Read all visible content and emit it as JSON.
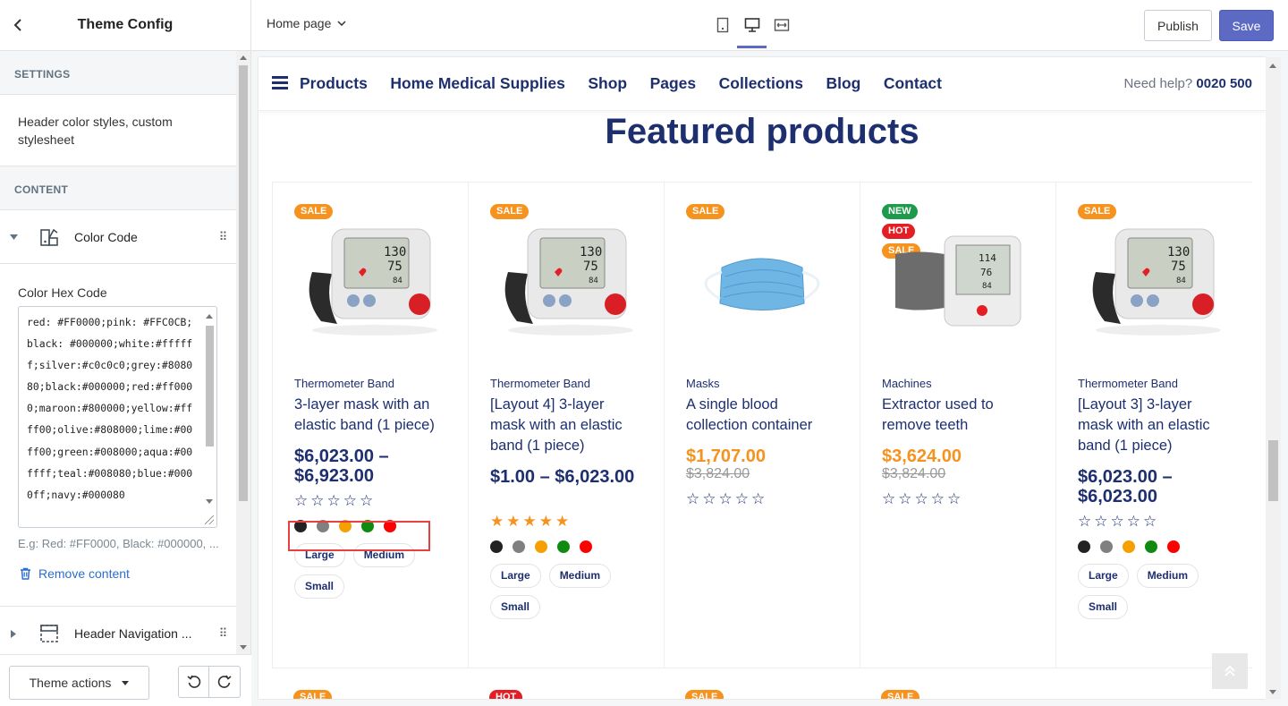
{
  "sidebar": {
    "title": "Theme Config",
    "settings_label": "SETTINGS",
    "settings_item": "Header color styles, custom stylesheet",
    "content_label": "CONTENT",
    "block1": {
      "name": "Color Code"
    },
    "field_label": "Color Hex Code",
    "textarea_value": "red: #FF0000;pink: #FFC0CB;black: #000000;white:#ffffff;silver:#c0c0c0;grey:#808080;black:#000000;red:#ff0000;maroon:#800000;yellow:#ffff00;olive:#808000;lime:#00ff00;green:#008000;aqua:#00ffff;teal:#008080;blue:#0000ff;navy:#000080",
    "hint": "E.g: Red: #FF0000, Black: #000000, ...",
    "remove_label": "Remove content",
    "block2": {
      "name": "Header Navigation ..."
    },
    "theme_actions_label": "Theme actions"
  },
  "topbar": {
    "page_label": "Home page",
    "publish_label": "Publish",
    "save_label": "Save"
  },
  "store": {
    "nav": [
      "Products",
      "Home Medical Supplies",
      "Shop",
      "Pages",
      "Collections",
      "Blog",
      "Contact"
    ],
    "help_label": "Need help?",
    "help_phone": "0020 500",
    "section_title": "Featured products"
  },
  "products": [
    {
      "badges": [
        "SALE"
      ],
      "category": "Thermometer Band",
      "name": "3-layer mask with an elastic band (1 piece)",
      "price": "$6,023.00 – $6,923.00",
      "old_price": "",
      "stars": "☆☆☆☆☆",
      "colors": [
        "#222222",
        "#808080",
        "#f6a000",
        "#118a11",
        "#ff0000"
      ],
      "sizes": [
        "Large",
        "Medium",
        "Small"
      ]
    },
    {
      "badges": [
        "SALE"
      ],
      "category": "Thermometer Band",
      "name": "[Layout 4] 3-layer mask with an elastic band (1 piece)",
      "price": "$1.00 – $6,023.00",
      "old_price": "",
      "stars": "★★★★★",
      "colors": [
        "#222222",
        "#808080",
        "#f6a000",
        "#118a11",
        "#ff0000"
      ],
      "sizes": [
        "Large",
        "Medium",
        "Small"
      ]
    },
    {
      "badges": [
        "SALE"
      ],
      "category": "Masks",
      "name": "A single blood collection container",
      "price": "$1,707.00",
      "old_price": "$3,824.00",
      "stars": "☆☆☆☆☆",
      "colors": [],
      "sizes": []
    },
    {
      "badges": [
        "NEW",
        "HOT",
        "SALE"
      ],
      "category": "Machines",
      "name": "Extractor used to remove teeth",
      "price": "$3,624.00",
      "old_price": "$3,824.00",
      "stars": "☆☆☆☆☆",
      "colors": [],
      "sizes": []
    },
    {
      "badges": [
        "SALE"
      ],
      "category": "Thermometer Band",
      "name": "[Layout 3] 3-layer mask with an elastic band (1 piece)",
      "price": "$6,023.00 – $6,023.00",
      "old_price": "",
      "stars": "☆☆☆☆☆",
      "colors": [
        "#222222",
        "#808080",
        "#f6a000",
        "#118a11",
        "#ff0000"
      ],
      "sizes": [
        "Large",
        "Medium",
        "Small"
      ]
    }
  ],
  "row2_badges": [
    "SALE",
    "HOT",
    "SALE",
    "SALE"
  ],
  "colors": {
    "accent": "#5c6ac4",
    "navy": "#1d2f6f",
    "orange": "#f6921e",
    "highlight": "#e8403f"
  }
}
